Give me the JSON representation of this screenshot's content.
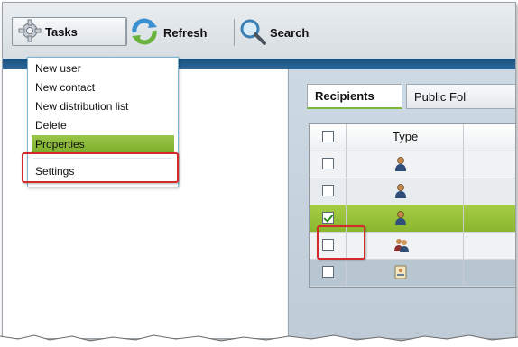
{
  "toolbar": {
    "tasks_label": "Tasks",
    "refresh_label": "Refresh",
    "search_label": "Search"
  },
  "tasks_menu": {
    "items": [
      {
        "label": "New user"
      },
      {
        "label": "New contact"
      },
      {
        "label": "New distribution list"
      },
      {
        "label": "Delete"
      },
      {
        "label": "Properties",
        "highlighted": true
      },
      {
        "label": "Settings"
      }
    ]
  },
  "tabs": [
    {
      "label": "Recipients",
      "active": true
    },
    {
      "label": "Public Fol"
    }
  ],
  "grid": {
    "columns": [
      "",
      "Type"
    ],
    "rows": [
      {
        "checked": false,
        "type_icon": "user-icon"
      },
      {
        "checked": false,
        "type_icon": "user-icon"
      },
      {
        "checked": true,
        "type_icon": "user-icon"
      },
      {
        "checked": false,
        "type_icon": "group-icon"
      },
      {
        "checked": false,
        "type_icon": "contact-card-icon"
      }
    ]
  },
  "colors": {
    "highlight_green": "#8ab62f",
    "annotation_red": "#d42a2a",
    "toolbar_strip_blue": "#1b4f7c"
  }
}
